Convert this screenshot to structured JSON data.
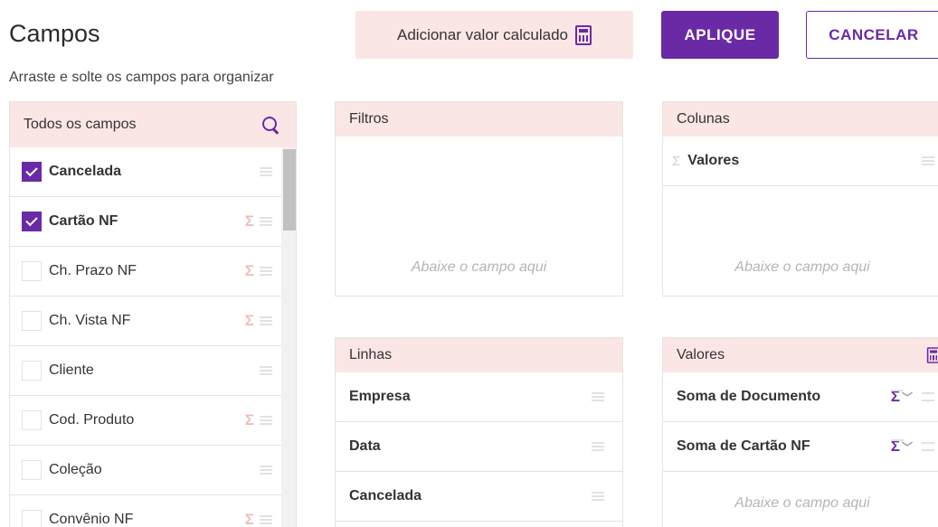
{
  "header": {
    "title": "Campos",
    "subtitle": "Arraste e solte os campos para organizar",
    "calc_button_label": "Adicionar valor calculado",
    "apply_label": "APLIQUE",
    "cancel_label": "CANCELAR"
  },
  "field_list": {
    "header": "Todos os campos",
    "items": [
      {
        "label": "Cancelada",
        "checked": true,
        "sigma": false
      },
      {
        "label": "Cartão NF",
        "checked": true,
        "sigma": true
      },
      {
        "label": "Ch. Prazo NF",
        "checked": false,
        "sigma": true
      },
      {
        "label": "Ch. Vista NF",
        "checked": false,
        "sigma": true
      },
      {
        "label": "Cliente",
        "checked": false,
        "sigma": false
      },
      {
        "label": "Cod. Produto",
        "checked": false,
        "sigma": true
      },
      {
        "label": "Coleção",
        "checked": false,
        "sigma": false
      },
      {
        "label": "Convênio NF",
        "checked": false,
        "sigma": true
      }
    ]
  },
  "zones": {
    "filtros": {
      "title": "Filtros",
      "placeholder": "Abaixe o campo aqui"
    },
    "colunas": {
      "title": "Colunas",
      "items": [
        "Valores"
      ],
      "placeholder": "Abaixe o campo aqui"
    },
    "linhas": {
      "title": "Linhas",
      "items": [
        "Empresa",
        "Data",
        "Cancelada"
      ]
    },
    "valores": {
      "title": "Valores",
      "items": [
        "Soma de Documento",
        "Soma de Cartão NF"
      ],
      "placeholder": "Abaixe o campo aqui"
    }
  },
  "colors": {
    "accent": "#6a2aa6",
    "header_bg": "#fbe6e6",
    "sigma_field": "#f3bcbc"
  },
  "icons": {
    "search": "search-icon",
    "calculator": "calculator-icon",
    "sigma": "sigma-icon",
    "drag": "drag-handle-icon"
  }
}
